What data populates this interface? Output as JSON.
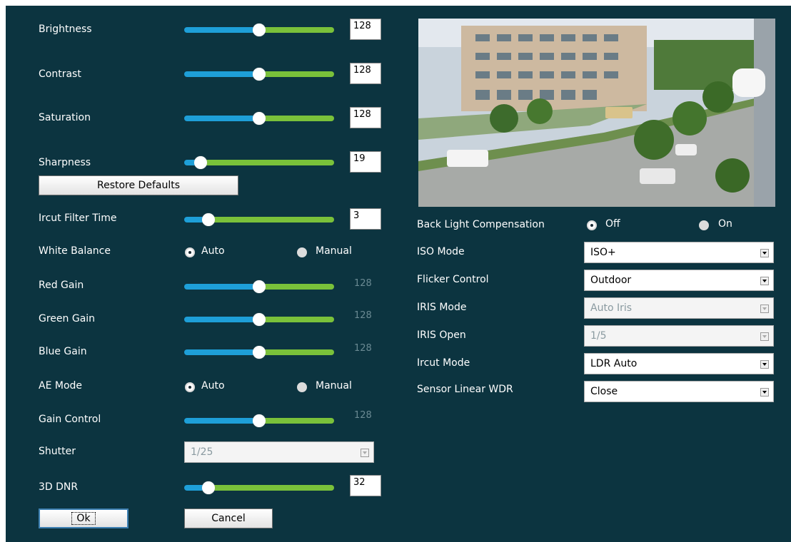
{
  "left": {
    "brightness": {
      "label": "Brightness",
      "value": "128",
      "level": 0.5
    },
    "contrast": {
      "label": "Contrast",
      "value": "128",
      "level": 0.5
    },
    "saturation": {
      "label": "Saturation",
      "value": "128",
      "level": 0.5
    },
    "sharpness": {
      "label": "Sharpness",
      "value": "19",
      "level": 0.11
    },
    "restore_defaults": "Restore Defaults",
    "ircut_filter_time": {
      "label": "Ircut Filter Time",
      "value": "3",
      "level": 0.16
    },
    "white_balance": {
      "label": "White Balance",
      "auto": "Auto",
      "manual": "Manual",
      "selected": "Auto"
    },
    "red_gain": {
      "label": "Red Gain",
      "value": "128",
      "level": 0.5
    },
    "green_gain": {
      "label": "Green Gain",
      "value": "128",
      "level": 0.5
    },
    "blue_gain": {
      "label": "Blue Gain",
      "value": "128",
      "level": 0.5
    },
    "ae_mode": {
      "label": "AE Mode",
      "auto": "Auto",
      "manual": "Manual",
      "selected": "Auto"
    },
    "gain_control": {
      "label": "Gain Control",
      "value": "128",
      "level": 0.5
    },
    "shutter": {
      "label": "Shutter",
      "value": "1/25"
    },
    "dnr": {
      "label": "3D DNR",
      "value": "32",
      "level": 0.16
    },
    "ok": "Ok",
    "cancel": "Cancel"
  },
  "right": {
    "blc": {
      "label": "Back Light Compensation",
      "off": "Off",
      "on": "On",
      "selected": "Off"
    },
    "iso_mode": {
      "label": "ISO Mode",
      "value": "ISO+"
    },
    "flicker_control": {
      "label": "Flicker Control",
      "value": "Outdoor"
    },
    "iris_mode": {
      "label": "IRIS Mode",
      "value": "Auto Iris"
    },
    "iris_open": {
      "label": "IRIS Open",
      "value": "1/5"
    },
    "ircut_mode": {
      "label": "Ircut Mode",
      "value": "LDR Auto"
    },
    "sensor_wdr": {
      "label": "Sensor Linear WDR",
      "value": "Close"
    }
  },
  "colors": {
    "background": "#0c3440",
    "slider_blue": "#1e9fd8",
    "slider_green": "#7ac13a"
  }
}
